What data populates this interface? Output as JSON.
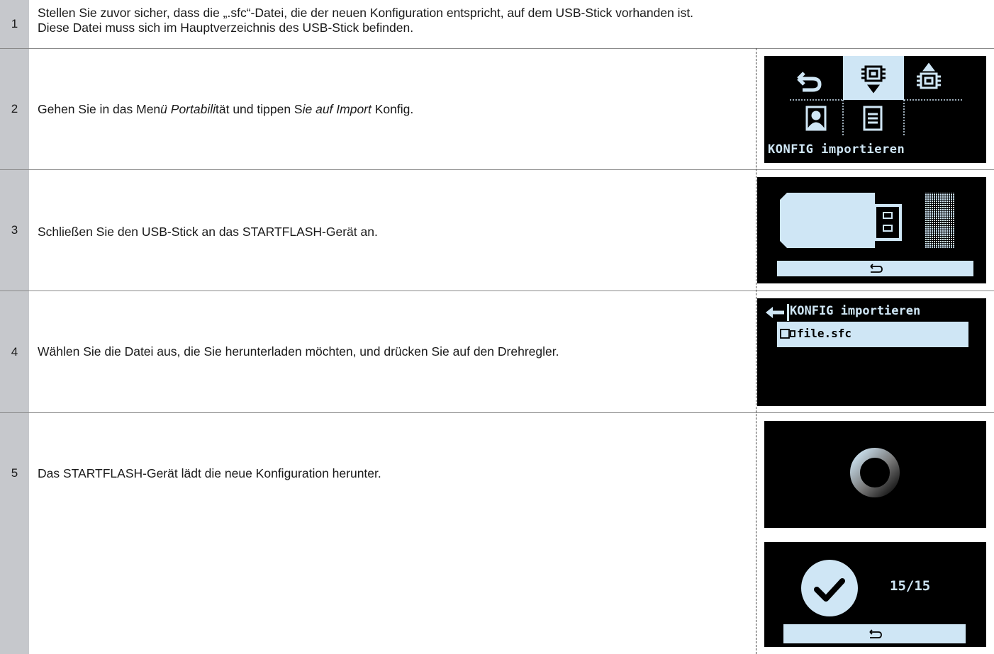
{
  "steps": [
    {
      "num": "1",
      "text_line1": "Stellen Sie zuvor sicher, dass die „.sfc“-Datei, die der neuen Konfiguration entspricht, auf dem USB-Stick vorhanden ist.",
      "text_line2": "Diese Datei muss sich im Hauptverzeichnis  des USB-Stick befinden."
    },
    {
      "num": "2",
      "text_a": "Gehen Sie in das Men",
      "text_b": "ü Portabili",
      "text_c": "tät und tippen S",
      "text_d": "ie auf Import",
      "text_e": " Konfig."
    },
    {
      "num": "3",
      "text": "Schließen Sie den USB-Stick an das STARTFLASH-Gerät an."
    },
    {
      "num": "4",
      "text": "Wählen Sie die Datei aus, die Sie herunterladen möchten, und drücken Sie auf den Drehregler."
    },
    {
      "num": "5",
      "text": "Das STARTFLASH-Gerät lädt die neue Konfiguration herunter."
    }
  ],
  "screens": {
    "menu": {
      "label": "KONFIG importieren"
    },
    "list": {
      "title": "KONFIG importieren",
      "file": "file.sfc"
    },
    "done": {
      "count": "15/15"
    }
  },
  "colors": {
    "screen_bg": "#000000",
    "highlight": "#cfe6f5",
    "step_bar": "#c6c8cc"
  }
}
